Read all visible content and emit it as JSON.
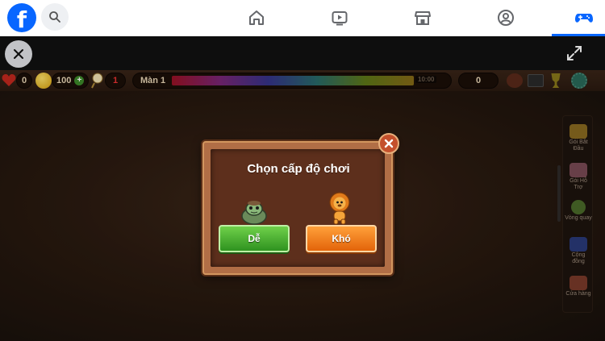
{
  "facebook": {
    "logo_letter": "f",
    "nav": [
      {
        "name": "home",
        "icon": "home-icon"
      },
      {
        "name": "watch",
        "icon": "video-icon"
      },
      {
        "name": "marketplace",
        "icon": "store-icon"
      },
      {
        "name": "groups",
        "icon": "groups-icon"
      },
      {
        "name": "gaming",
        "icon": "gamepad-icon",
        "active": true
      }
    ],
    "accent": "#0866ff"
  },
  "hud": {
    "lives": "0",
    "coins": "100",
    "hint_count": "1",
    "level_label": "Màn 1",
    "timer": "10:00",
    "score": "0"
  },
  "dialog": {
    "title": "Chọn cấp độ chơi",
    "easy_label": "Dễ",
    "hard_label": "Khó"
  },
  "side_panel": [
    {
      "label": "Gói Bắt Đầu",
      "color": "#c9a33a"
    },
    {
      "label": "Gói Hỗ Trợ",
      "color": "#c78390"
    },
    {
      "label": "Vòng quay",
      "color": "#7ab84a"
    },
    {
      "label": "Cộng đồng",
      "color": "#3b5bb0"
    },
    {
      "label": "Cửa hàng",
      "color": "#c05a3a"
    }
  ]
}
